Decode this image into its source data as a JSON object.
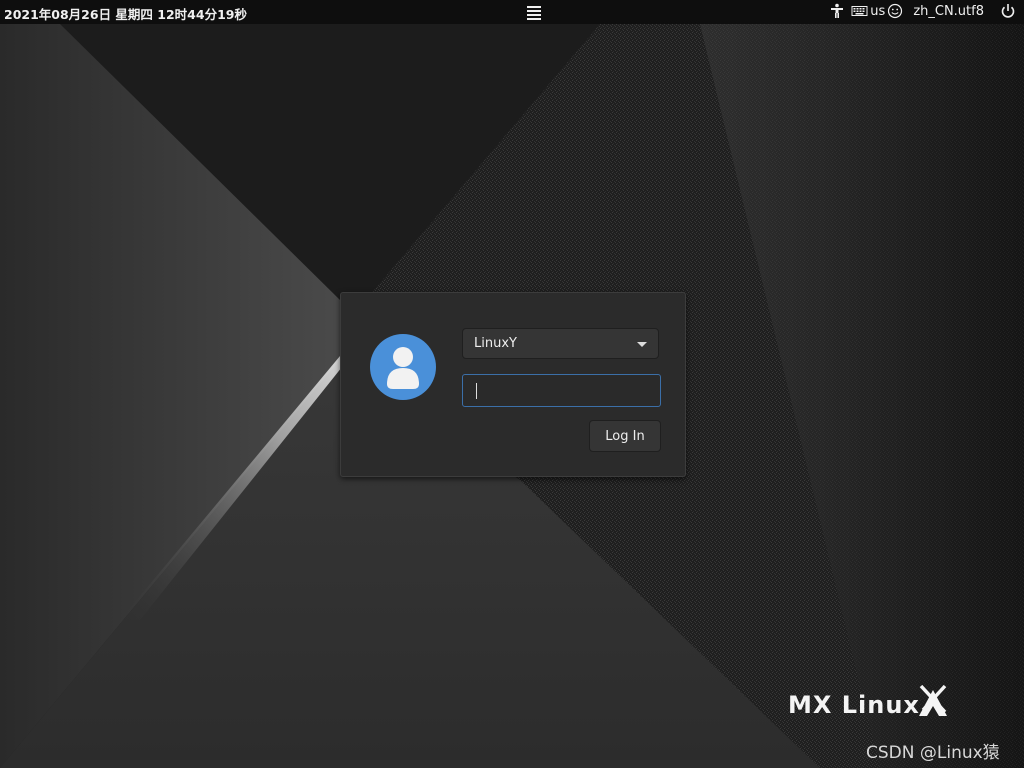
{
  "topbar": {
    "datetime": "2021年08月26日 星期四 12时44分19秒",
    "menu_icon": "hamburger-menu-icon",
    "accessibility_icon": "accessibility-icon",
    "keyboard_icon": "keyboard-icon",
    "keyboard_layout": "us",
    "session_icon": "smiley-icon",
    "locale": "zh_CN.utf8",
    "power_icon": "power-icon"
  },
  "login": {
    "avatar_icon": "user-avatar-icon",
    "selected_user": "LinuxY",
    "password_value": "",
    "login_button": "Log In"
  },
  "branding": {
    "logo_text": "MX Linux",
    "watermark": "CSDN @Linux猿"
  },
  "colors": {
    "avatar": "#4a90d9",
    "focus_border": "#3b6fa8",
    "panel": "#0e0e0e",
    "dialog": "#2b2b2b"
  }
}
